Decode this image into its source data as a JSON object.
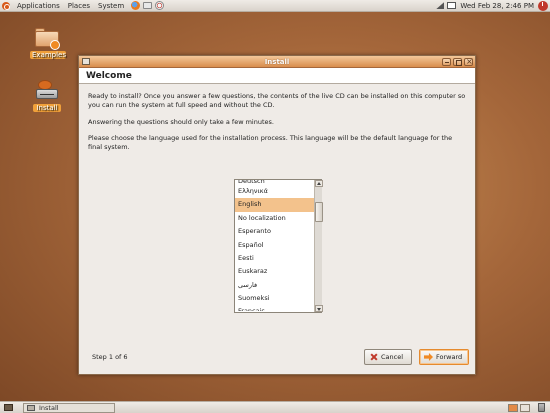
{
  "top_panel": {
    "menus": [
      "Applications",
      "Places",
      "System"
    ],
    "clock": "Wed Feb 28,  2:46 PM"
  },
  "desktop": {
    "icons": [
      {
        "label": "Examples"
      },
      {
        "label": "Install"
      }
    ]
  },
  "window": {
    "title": "Install",
    "heading": "Welcome",
    "paragraphs": [
      "Ready to install? Once you answer a few questions, the contents of the live CD can be installed on this computer so you can run the system at full speed and without the CD.",
      "Answering the questions should only take a few minutes.",
      "Please choose the language used for the installation process. This language will be the default language for the final system."
    ],
    "languages": {
      "partial_top": "Deutsch",
      "items": [
        "Ελληνικά",
        "English",
        "No localization",
        "Esperanto",
        "Español",
        "Eesti",
        "Euskaraz",
        "فارسی",
        "Suomeksi"
      ],
      "selected": "English",
      "partial_bottom": "Français"
    },
    "step": "Step 1 of 6",
    "buttons": {
      "cancel": "Cancel",
      "forward": "Forward"
    }
  },
  "bottom_panel": {
    "task_label": "Install"
  }
}
